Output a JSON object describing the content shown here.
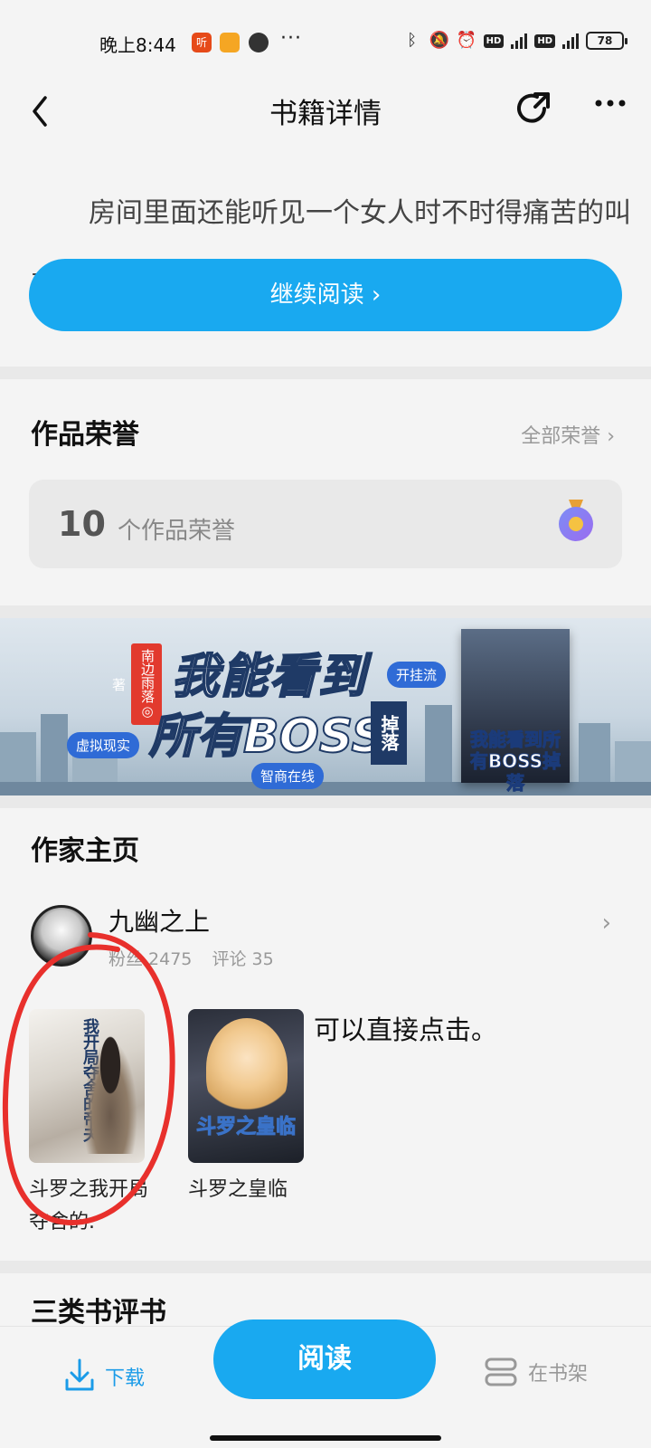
{
  "status_bar": {
    "time": "晚上8:44",
    "app_badge": "听",
    "dots": "···",
    "network": "4G",
    "battery": "78"
  },
  "header": {
    "title": "书籍详情",
    "back_icon": "chevron-left-icon",
    "share_icon": "share-icon",
    "more_icon": "more-icon"
  },
  "preview": {
    "text": "房间里面还能听见一个女人时不时得痛苦的叫声",
    "continue_label": "继续阅读 ›"
  },
  "honors": {
    "title": "作品荣誉",
    "all_label": "全部荣誉 ›",
    "count": "10",
    "count_label": "个作品荣誉",
    "medal_icon": "medal-icon"
  },
  "banner": {
    "author_tag": "南边雨落◎著",
    "title_line1": "我能看到",
    "title_line2": "所有BOSS",
    "drop_label": "掉落",
    "tag_genre": "虚拟现实",
    "tag_style": "开挂流",
    "tag_publisher": "智商在线",
    "cover_title": "我能看到所有BOSS掉落"
  },
  "author": {
    "section_title": "作家主页",
    "name": "九幽之上",
    "fans_label": "粉丝 2475",
    "comments_label": "评论 35",
    "arrow": "›",
    "books": [
      {
        "title": "斗罗之我开局夺舍的.",
        "cover_text": "我开局夺舍的帝夫"
      },
      {
        "title": "斗罗之皇临",
        "cover_text": "斗罗之皇临"
      }
    ],
    "note": "可以直接点击。"
  },
  "next_section": {
    "title": "三类书评书"
  },
  "bottom_bar": {
    "download_label": "下载",
    "read_label": "阅读",
    "shelf_label": "在书架"
  },
  "colors": {
    "accent": "#19a9f0",
    "annotation": "#e8302c"
  }
}
